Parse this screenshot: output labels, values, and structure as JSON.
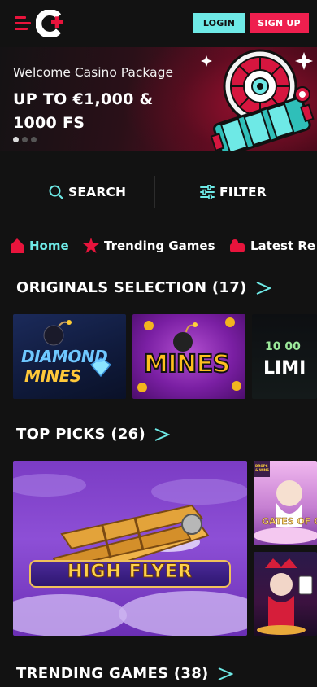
{
  "header": {
    "login_label": "LOGIN",
    "signup_label": "SIGN UP"
  },
  "banner": {
    "subtitle": "Welcome Casino Package",
    "title": "UP TO €1,000 & 1000 FS",
    "slides": 3,
    "active_slide": 1
  },
  "toolbar": {
    "search_label": "SEARCH",
    "filter_label": "FILTER"
  },
  "nav": {
    "items": [
      {
        "label": "Home",
        "icon": "home-icon",
        "active": true
      },
      {
        "label": "Trending Games",
        "icon": "star-icon",
        "active": false
      },
      {
        "label": "Latest Re",
        "icon": "slot-icon",
        "active": false
      }
    ]
  },
  "sections": [
    {
      "title": "ORIGINALS SELECTION (17)",
      "tiles": [
        {
          "label_top": "DIAMOND",
          "label_bottom": "MINES"
        },
        {
          "label_top": "MINES"
        },
        {
          "label_top": "10 00",
          "label_bottom": "LIMI"
        }
      ]
    },
    {
      "title": "TOP PICKS (26)",
      "tiles": [
        {
          "label_top": "HIGH FLYER"
        },
        {
          "label_top": "GATES OF OLY",
          "badge": "DROPS & WINS"
        },
        {
          "label_top": ""
        }
      ]
    },
    {
      "title": "TRENDING GAMES (38)"
    }
  ],
  "colors": {
    "accent_cyan": "#6ee9e6",
    "accent_red": "#ee1f4e",
    "background": "#121212"
  }
}
